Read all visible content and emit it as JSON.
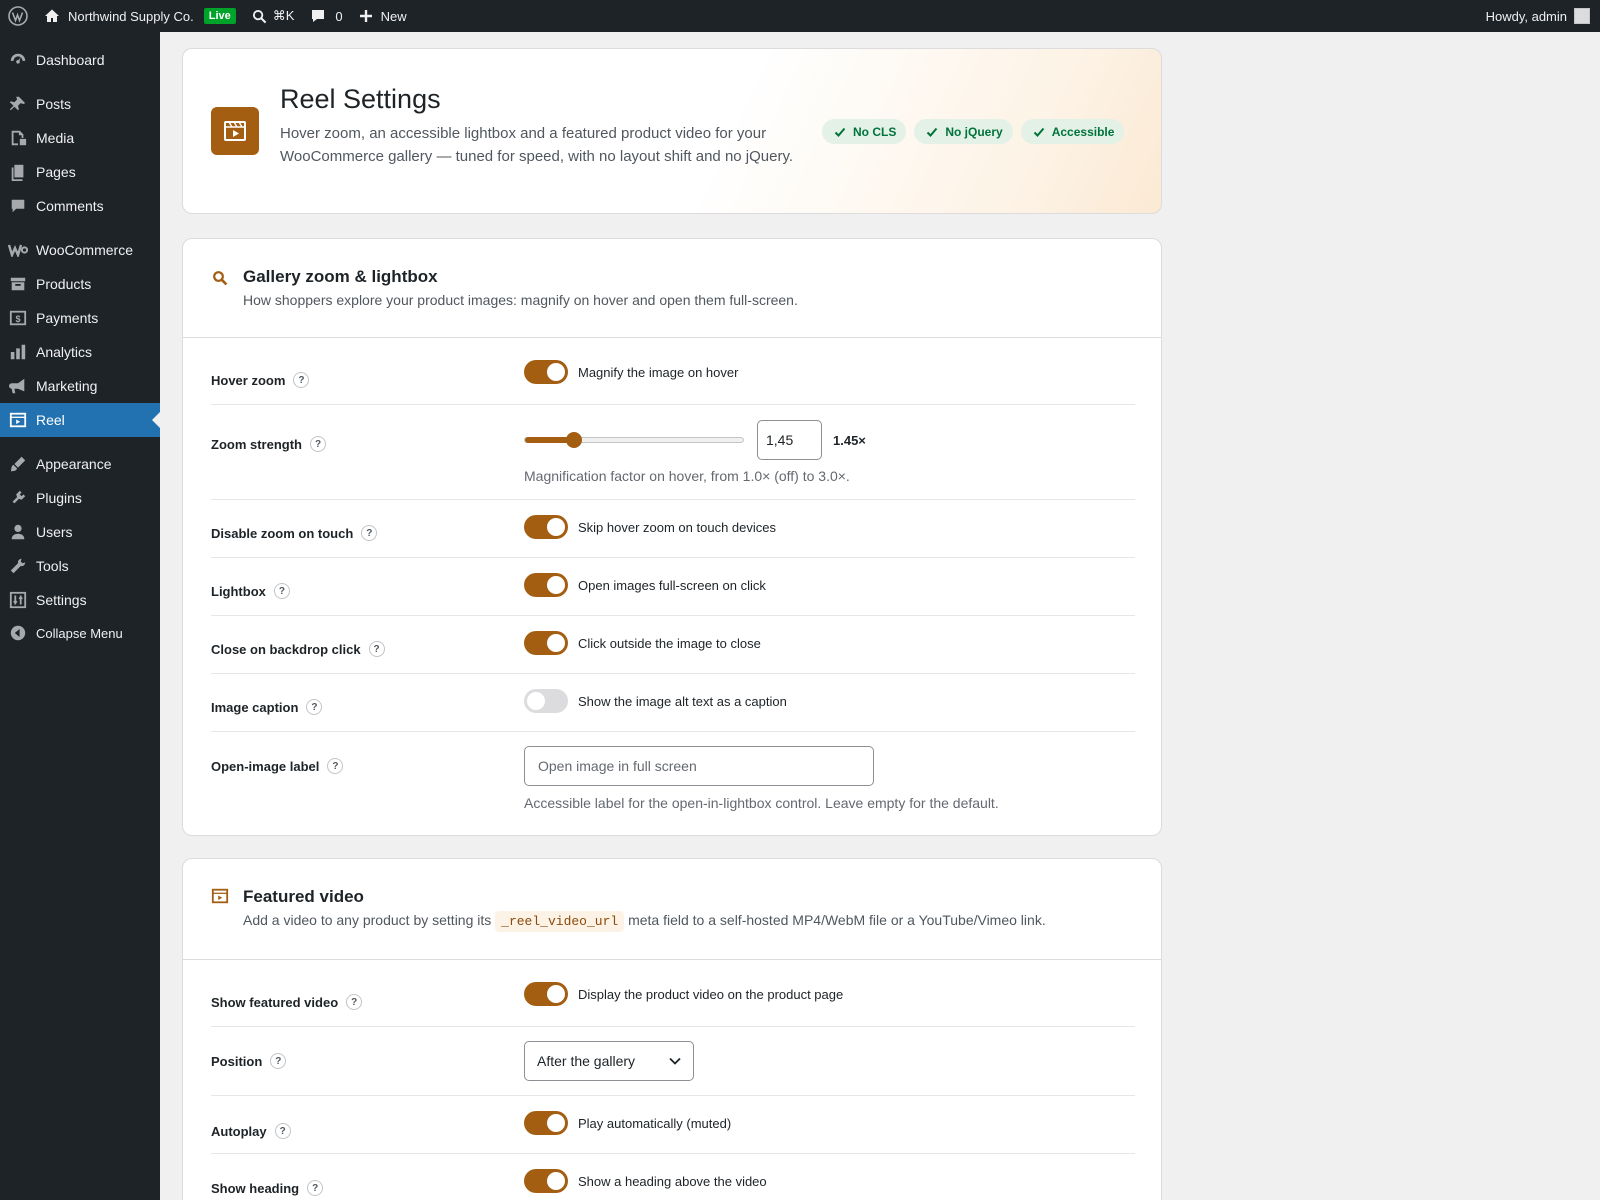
{
  "adminbar": {
    "site_name": "Northwind Supply Co.",
    "live_badge": "Live",
    "search_shortcut": "⌘K",
    "comments_count": "0",
    "new_label": "New",
    "howdy": "Howdy, admin"
  },
  "sidebar": {
    "items": [
      {
        "label": "Dashboard",
        "icon": "dashboard-icon"
      },
      {
        "label": "Posts",
        "icon": "pin-icon"
      },
      {
        "label": "Media",
        "icon": "media-icon"
      },
      {
        "label": "Pages",
        "icon": "pages-icon"
      },
      {
        "label": "Comments",
        "icon": "comment-icon"
      },
      {
        "label": "WooCommerce",
        "icon": "woocommerce-icon"
      },
      {
        "label": "Products",
        "icon": "archive-icon"
      },
      {
        "label": "Payments",
        "icon": "payments-icon"
      },
      {
        "label": "Analytics",
        "icon": "chart-icon"
      },
      {
        "label": "Marketing",
        "icon": "megaphone-icon"
      },
      {
        "label": "Reel",
        "icon": "film-icon",
        "active": true
      },
      {
        "label": "Appearance",
        "icon": "brush-icon"
      },
      {
        "label": "Plugins",
        "icon": "plug-icon"
      },
      {
        "label": "Users",
        "icon": "user-icon"
      },
      {
        "label": "Tools",
        "icon": "wrench-icon"
      },
      {
        "label": "Settings",
        "icon": "sliders-icon"
      },
      {
        "label": "Collapse Menu",
        "icon": "collapse-icon"
      }
    ]
  },
  "hero": {
    "title": "Reel Settings",
    "description": "Hover zoom, an accessible lightbox and a featured product video for your WooCommerce gallery — tuned for speed, with no layout shift and no jQuery.",
    "badges": [
      "No CLS",
      "No jQuery",
      "Accessible"
    ]
  },
  "gallery": {
    "title": "Gallery zoom & lightbox",
    "description": "How shoppers explore your product images: magnify on hover and open them full-screen.",
    "hover_zoom": {
      "label": "Hover zoom",
      "text": "Magnify the image on hover",
      "on": true
    },
    "zoom_strength": {
      "label": "Zoom strength",
      "value": "1,45",
      "readout": "1.45×",
      "fraction": 0.225,
      "hint": "Magnification factor on hover, from 1.0× (off) to 3.0×."
    },
    "disable_touch": {
      "label": "Disable zoom on touch",
      "text": "Skip hover zoom on touch devices",
      "on": true
    },
    "lightbox": {
      "label": "Lightbox",
      "text": "Open images full-screen on click",
      "on": true
    },
    "close_backdrop": {
      "label": "Close on backdrop click",
      "text": "Click outside the image to close",
      "on": true
    },
    "image_caption": {
      "label": "Image caption",
      "text": "Show the image alt text as a caption",
      "on": false
    },
    "open_label": {
      "label": "Open-image label",
      "placeholder": "Open image in full screen",
      "hint": "Accessible label for the open-in-lightbox control. Leave empty for the default."
    }
  },
  "video": {
    "title": "Featured video",
    "description_before": "Add a video to any product by setting its",
    "code": "_reel_video_url",
    "description_after": "meta field to a self-hosted MP4/WebM file or a YouTube/Vimeo link.",
    "show_video": {
      "label": "Show featured video",
      "text": "Display the product video on the product page",
      "on": true
    },
    "position": {
      "label": "Position",
      "value": "After the gallery"
    },
    "autoplay": {
      "label": "Autoplay",
      "text": "Play automatically (muted)",
      "on": true
    },
    "show_heading": {
      "label": "Show heading",
      "text": "Show a heading above the video",
      "on": true
    }
  },
  "help_mark": "?",
  "colors": {
    "accent": "#a35e12",
    "admin_bar": "#1d2327",
    "menu_active": "#2271b1",
    "badge_green": "#00733c"
  }
}
